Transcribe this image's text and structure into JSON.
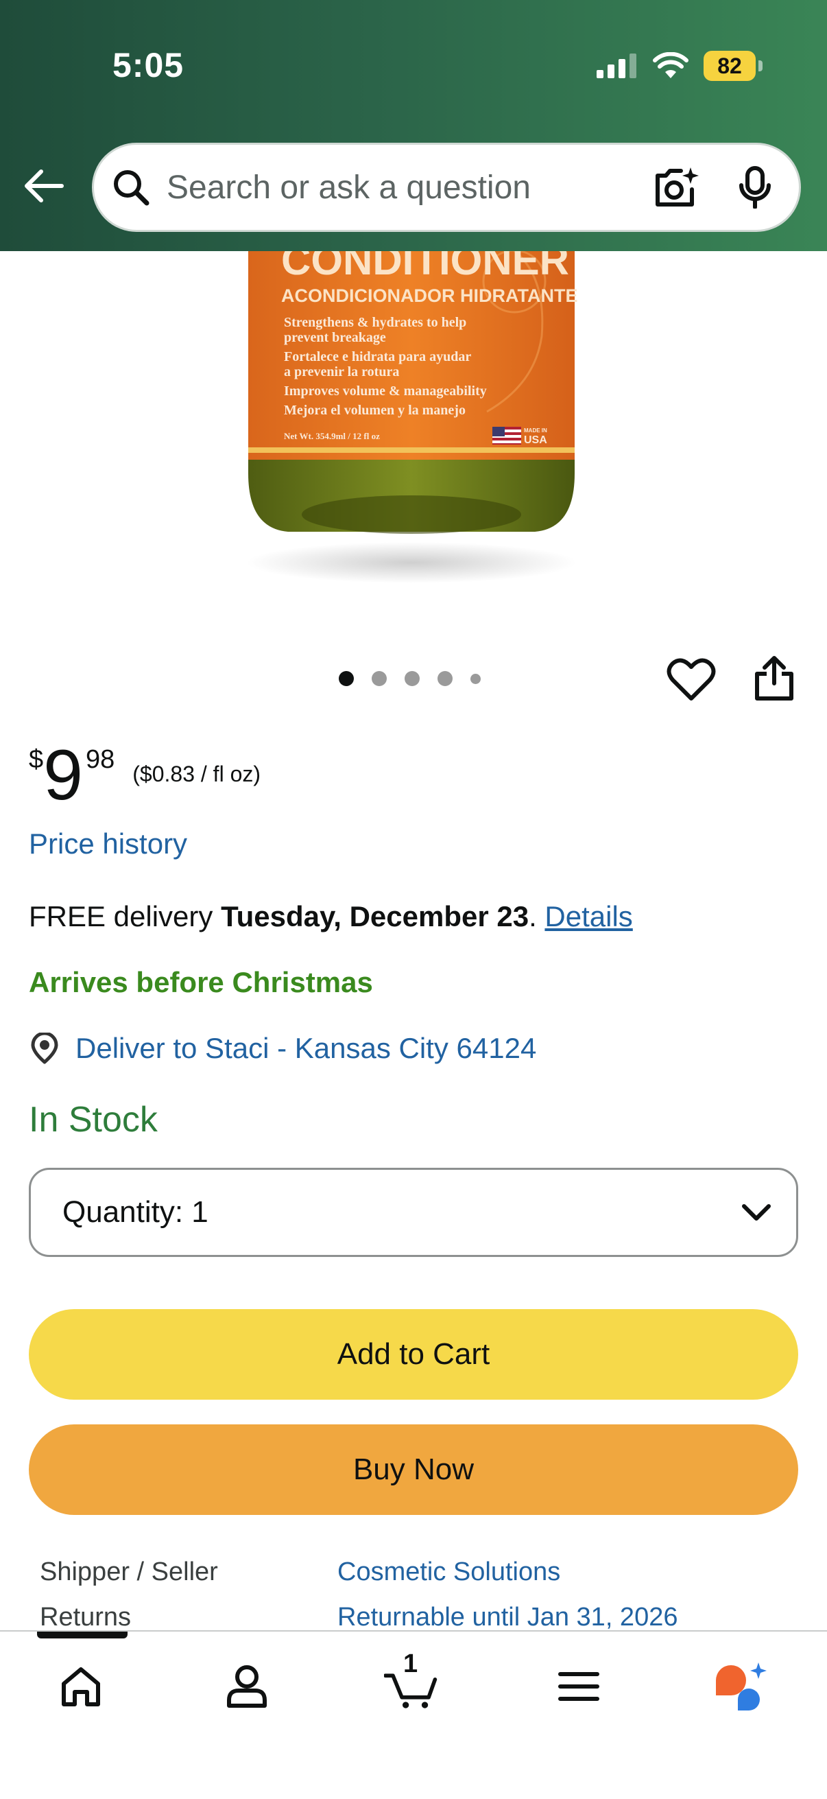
{
  "status_bar": {
    "time": "5:05",
    "battery": "82"
  },
  "search": {
    "placeholder": "Search or ask a question"
  },
  "product_image": {
    "brand_line": "CONDITIONER",
    "subtitle": "ACONDICIONADOR HIDRATANTE",
    "lines": [
      "Strengthens & hydrates to help",
      "prevent breakage",
      "Fortalece e hidrata para ayudar",
      "a prevenir la rotura",
      "Improves volume & manageability",
      "Mejora el volumen y la manejo"
    ],
    "net_wt": "Net Wt. 354.9ml / 12 fl oz",
    "made_in": "MADE IN",
    "usa": "USA"
  },
  "carousel": {
    "total": 5,
    "active_index": 0
  },
  "price": {
    "symbol": "$",
    "whole": "9",
    "fraction": "98",
    "unit": "($0.83 / fl oz)"
  },
  "price_history_label": "Price history",
  "delivery": {
    "prefix": "FREE delivery ",
    "date": "Tuesday, December 23",
    "period": ".",
    "details": "Details"
  },
  "arrives_label": "Arrives before Christmas",
  "deliver_to": "Deliver to Staci - Kansas City 64124",
  "stock_status": "In Stock",
  "quantity_label": "Quantity: 1",
  "buttons": {
    "add_to_cart": "Add to Cart",
    "buy_now": "Buy Now"
  },
  "info": [
    {
      "label": "Shipper / Seller",
      "value": "Cosmetic Solutions"
    },
    {
      "label": "Returns",
      "value": "Returnable until Jan 31, 2026"
    }
  ],
  "cart": {
    "count": "1"
  },
  "colors": {
    "header_start": "#1f4c3a",
    "header_end": "#3a8556",
    "add_to_cart": "#f6d94a",
    "buy_now": "#f0a73f",
    "link": "#2162a1",
    "in_stock": "#2e7d3b",
    "arrives": "#3a8a1e"
  },
  "icons": [
    "back-arrow-icon",
    "search-icon",
    "camera-search-icon",
    "microphone-icon",
    "heart-icon",
    "share-icon",
    "location-pin-icon",
    "chevron-down-icon",
    "home-icon",
    "account-icon",
    "cart-icon",
    "menu-icon",
    "rufus-assistant-icon"
  ]
}
